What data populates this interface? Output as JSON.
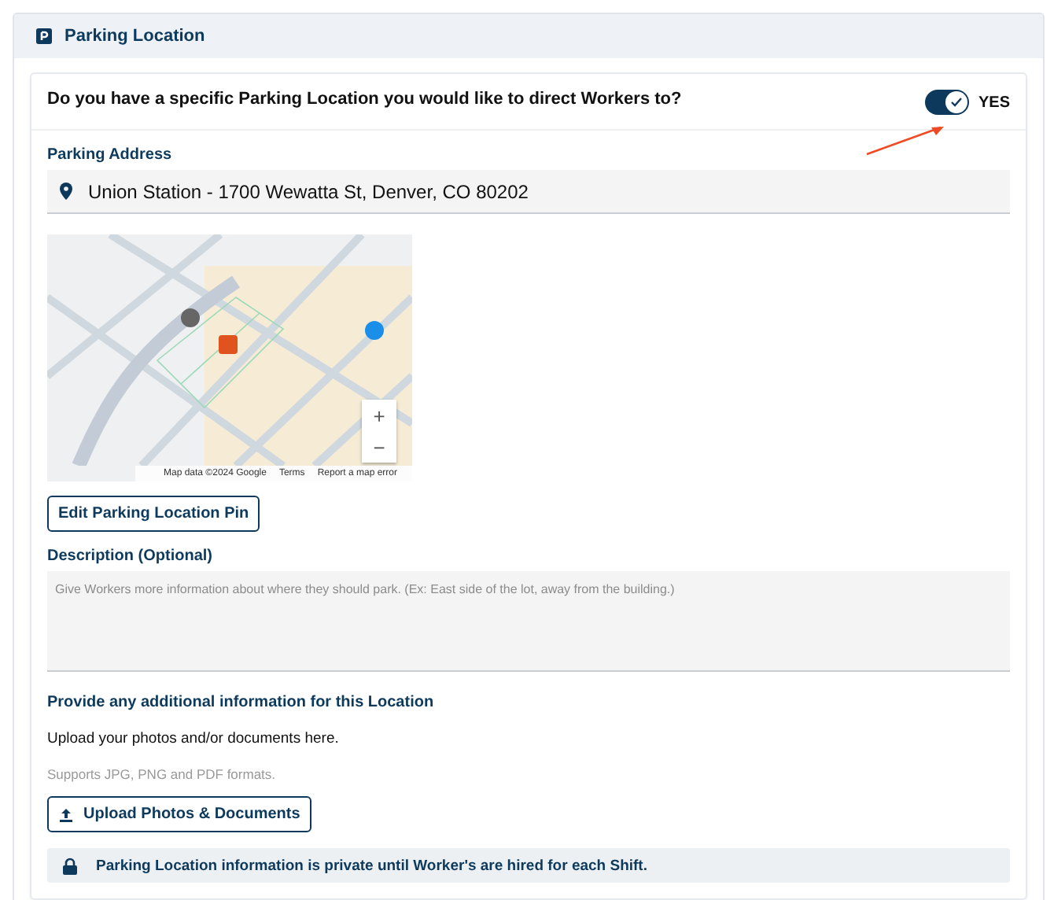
{
  "section": {
    "title": "Parking Location"
  },
  "question": {
    "text": "Do you have a specific Parking Location you would like to direct Workers to?",
    "toggle": {
      "on": true,
      "label": "YES"
    }
  },
  "address": {
    "label": "Parking Address",
    "value": "Union Station - 1700 Wewatta St, Denver, CO 80202"
  },
  "map": {
    "zoom_in": "+",
    "zoom_out": "−",
    "attribution": [
      "Map data ©2024 Google",
      "Terms",
      "Report a map error"
    ]
  },
  "edit_pin_button": "Edit Parking Location Pin",
  "description": {
    "label": "Description (Optional)",
    "placeholder": "Give Workers more information about where they should park. (Ex: East side of the lot, away from the building.)"
  },
  "additional": {
    "heading": "Provide any additional information for this Location",
    "text": "Upload your photos and/or documents here.",
    "hint": "Supports JPG, PNG and PDF formats.",
    "upload_button": "Upload Photos & Documents"
  },
  "notice": "Parking Location information is private until Worker's are hired for each Shift."
}
